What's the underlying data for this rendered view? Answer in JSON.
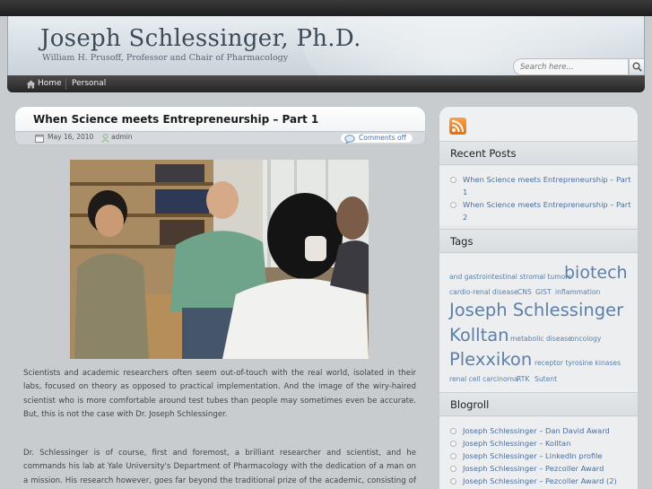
{
  "header": {
    "title": "Joseph Schlessinger, Ph.D.",
    "description": "William H. Prusoff, Professor and Chair of Pharmacology",
    "search_placeholder": "Search here..."
  },
  "nav": {
    "items": [
      {
        "label": "Home",
        "icon": "home-icon"
      },
      {
        "label": "Personal"
      }
    ]
  },
  "post": {
    "title": "When Science meets Entrepreneurship – Part 1",
    "date": "May 16, 2010",
    "author": "admin",
    "comments": "Comments off",
    "paragraphs": [
      "Scientists and academic researchers often seem out-of-touch with the real world, isolated in their labs, focused on theory as opposed to practical implementation. And the image of the wiry-haired scientist who is more comfortable around test tubes than people may sometimes even be accurate. But, this is not the case with Dr. Joseph Schlessinger.",
      "Dr. Schlessinger is of course, first and foremost, a brilliant researcher and scientist, and he commands his lab at Yale University's Department of Pharmacology with the dedication of a man on a mission. His research however, goes far beyond the traditional prize of the academic, consisting of recognition by peers and"
    ]
  },
  "sidebar": {
    "recent_posts": {
      "title": "Recent Posts",
      "items": [
        {
          "line1": "When Science meets Entrepreneurship – Part",
          "line2": "1"
        },
        {
          "line1": "When Science meets Entrepreneurship – Part",
          "line2": "2"
        }
      ]
    },
    "tags": {
      "title": "Tags",
      "items": [
        "and gastrointestinal stromal tumors",
        "biotech",
        "cardio-renal disease",
        "CNS",
        "GIST",
        "inflammation",
        "Joseph Schlessinger",
        "Kolltan",
        "metabolic disease",
        "oncology",
        "Plexxikon",
        "receptor tyrosine kinases",
        "renal cell carcinoma",
        "RTK",
        "Sutent"
      ]
    },
    "blogroll": {
      "title": "Blogroll",
      "items": [
        "Joseph Schlessinger – Dan David Award",
        "Joseph Schlessinger – Kolltan",
        "Joseph Schlessinger – LinkedIn profile",
        "Joseph Schlessinger – Pezcoller Award",
        "Joseph Schlessinger – Pezcoller Award (2)"
      ]
    }
  },
  "colors": {
    "link": "#4a6ea0",
    "navbar": "#2f2f2f",
    "rss": "#e87a1e"
  }
}
